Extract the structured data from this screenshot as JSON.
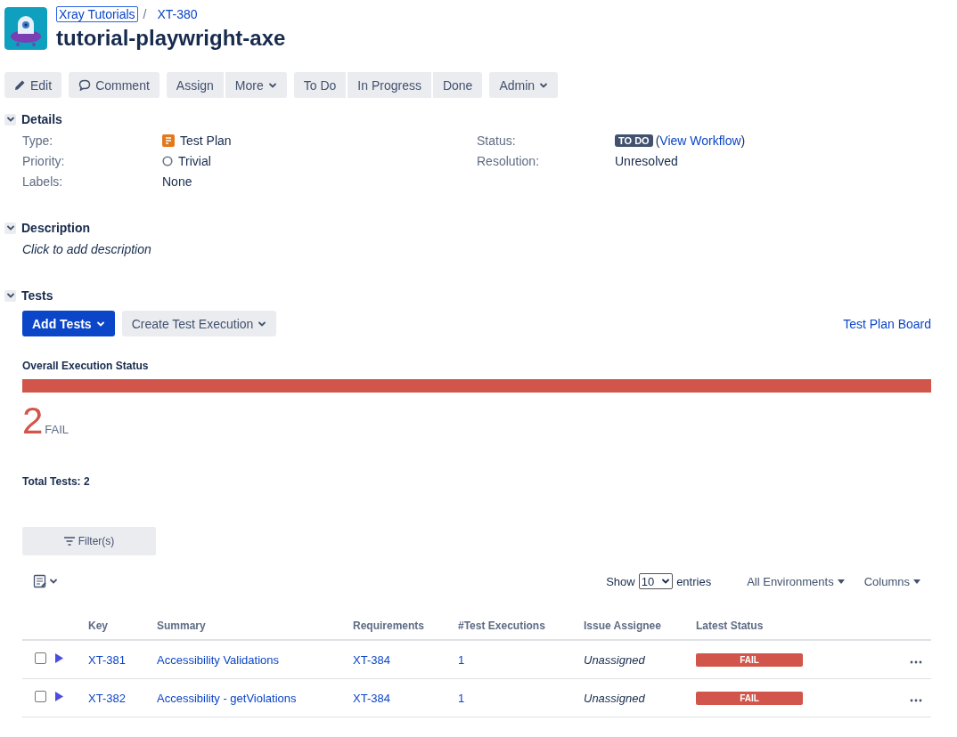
{
  "breadcrumb": {
    "project": "Xray Tutorials",
    "separator": "/",
    "issue_key": "XT-380"
  },
  "title": "tutorial-playwright-axe",
  "toolbar": [
    [
      {
        "label": "Edit",
        "kind": "pencil"
      }
    ],
    [
      {
        "label": "Comment",
        "kind": "comment"
      }
    ],
    [
      {
        "label": "Assign",
        "kind": "plain"
      },
      {
        "label": "More",
        "kind": "dropdown"
      }
    ],
    [
      {
        "label": "To Do",
        "kind": "plain"
      },
      {
        "label": "In Progress",
        "kind": "plain"
      },
      {
        "label": "Done",
        "kind": "plain"
      }
    ],
    [
      {
        "label": "Admin",
        "kind": "dropdown"
      }
    ]
  ],
  "details": {
    "heading": "Details",
    "expanded": true,
    "left": [
      {
        "label": "Type:",
        "value": "Test Plan",
        "kind": "type"
      },
      {
        "label": "Priority:",
        "value": "Trivial",
        "kind": "priority"
      },
      {
        "label": "Labels:",
        "value": "None",
        "kind": "plain"
      }
    ],
    "right": [
      {
        "label": "Status:",
        "badge": "TO DO",
        "open_paren": "(",
        "link": "View Workflow",
        "close_paren": ")",
        "kind": "status"
      },
      {
        "label": "Resolution:",
        "value": "Unresolved",
        "kind": "plain"
      }
    ]
  },
  "description": {
    "heading": "Description",
    "expanded": true,
    "placeholder": "Click to add description"
  },
  "tests": {
    "heading": "Tests",
    "expanded": true,
    "add_button": "Add Tests",
    "create_button": "Create Test Execution",
    "board_link": "Test Plan Board",
    "overall_label": "Overall Execution Status",
    "segments": [
      {
        "level": 1,
        "color": "#d1554a"
      }
    ],
    "count": "2",
    "count_status": "FAIL",
    "total": "Total Tests: 2",
    "filter_button": "Filter(s)",
    "show_label": "Show",
    "page_size": "10",
    "entries_label": "entries",
    "environments": "All Environments",
    "columns_button": "Columns",
    "table": {
      "columns": [
        "Key",
        "Summary",
        "Requirements",
        "#Test Executions",
        "Issue Assignee",
        "Latest Status"
      ],
      "rows": [
        {
          "checked": false,
          "key": "XT-381",
          "summary": "Accessibility Validations",
          "requirement": "XT-384",
          "executions": "1",
          "assignee": "Unassigned",
          "status": "FAIL",
          "color": "#d1554a"
        },
        {
          "checked": false,
          "key": "XT-382",
          "summary": "Accessibility - getViolations",
          "requirement": "XT-384",
          "executions": "1",
          "assignee": "Unassigned",
          "status": "FAIL",
          "color": "#d1554a"
        }
      ]
    }
  }
}
